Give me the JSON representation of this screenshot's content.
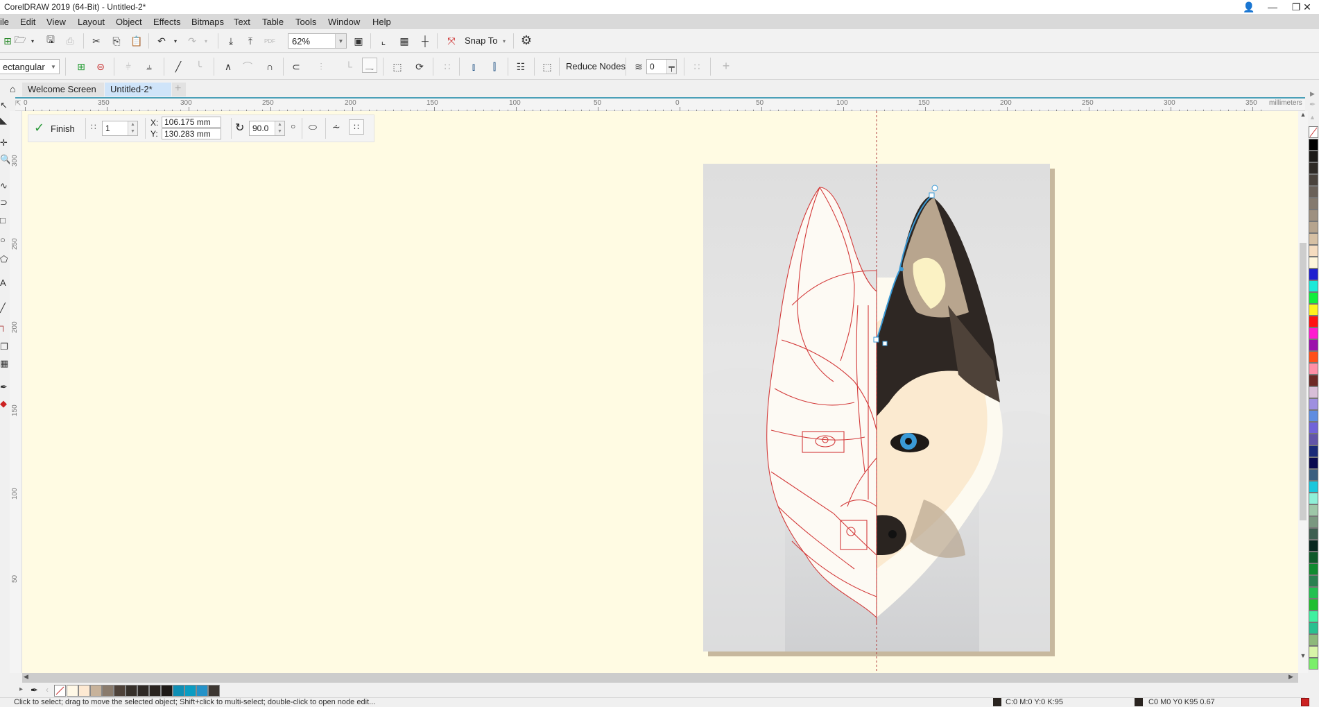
{
  "window": {
    "title": "CorelDRAW 2019 (64-Bit) - Untitled-2*",
    "controls": [
      "account-icon",
      "minimize-icon",
      "restore-icon",
      "close-icon"
    ]
  },
  "menu": [
    "ile",
    "Edit",
    "View",
    "Layout",
    "Object",
    "Effects",
    "Bitmaps",
    "Text",
    "Table",
    "Tools",
    "Window",
    "Help"
  ],
  "standard_toolbar": {
    "zoom_level": "62%",
    "snap_to_label": "Snap To",
    "pdf_label": "PDF"
  },
  "property_bar": {
    "selection_mode": "ectangular",
    "reduce_nodes_label": "Reduce Nodes",
    "curve_smoothness": "0"
  },
  "document_tabs": [
    {
      "label": "Welcome Screen",
      "active": false
    },
    {
      "label": "Untitled-2*",
      "active": true
    }
  ],
  "horizontal_ruler": {
    "labels": [
      "0",
      "350",
      "300",
      "250",
      "200",
      "150",
      "100",
      "50",
      "0",
      "50",
      "100",
      "150",
      "200",
      "250",
      "300",
      "350"
    ],
    "units": "millimeters"
  },
  "vertical_ruler": {
    "labels": [
      "300",
      "250",
      "200",
      "150",
      "100",
      "50"
    ]
  },
  "node_edit_bar": {
    "finish_label": "Finish",
    "node_count": "1",
    "x_label": "X:",
    "x_value": "106.175 mm",
    "y_label": "Y:",
    "y_value": "130.283 mm",
    "rotation": "90.0"
  },
  "document_palette": {
    "colors": [
      "#fff8e6",
      "#fde9d2",
      "#c7b29a",
      "#8a7b6c",
      "#4e4239",
      "#36302a",
      "#2e2925",
      "#2a2420",
      "#1e1a17",
      "#0f8fb5",
      "#0b9cc2",
      "#2492c8",
      "#3d3732"
    ]
  },
  "color_palette": {
    "colors": [
      "#000000",
      "#1c1a18",
      "#2e2a26",
      "#4a433d",
      "#6a6159",
      "#857a6e",
      "#9e9080",
      "#b6a48e",
      "#d6c0a4",
      "#f5dcc0",
      "#fff6dc",
      "#1f1fd0",
      "#1de9d9",
      "#12ee3c",
      "#fff21f",
      "#ff1212",
      "#ff1ad0",
      "#9b11ab",
      "#ff4f1a",
      "#ff8fa6",
      "#6e2a26",
      "#d8bfd8",
      "#9e8fe0",
      "#5f8de0",
      "#7163d8",
      "#6255a8",
      "#1a2a78",
      "#0a0a50",
      "#3a5f80",
      "#1bc7dc",
      "#8ff0d8",
      "#9ec7a8",
      "#7a9880",
      "#3d5e50",
      "#08281f",
      "#0e5a2a",
      "#0f8a2f",
      "#2a8050",
      "#22c050",
      "#1fbf2f",
      "#3ff0a0",
      "#2ac090",
      "#8db87a",
      "#d8f5a8",
      "#7aef6a"
    ]
  },
  "status_bar": {
    "hint": "Click to select; drag to move the selected object; Shift+click to multi-select; double-click to open node edit...",
    "fill_info": "C:0 M:0 Y:0 K:95",
    "outline_info": "C0 M0 Y0 K95  0.67"
  },
  "artwork": {
    "description": "Husky/wolf head illustration, left half shown as red wireframe, right half filled",
    "colors": {
      "wireframe": "#d33a3a",
      "ear_dark": "#2e2723",
      "ear_inner": "#b8a58e",
      "ear_highlight": "#fbf2c4",
      "face_cream": "#fbead0",
      "face_light": "#fdfaf0",
      "eye_iris": "#3a9ad6",
      "nose": "#2a2420",
      "page_bg": "#dcdcdc",
      "node_selection": "#3a9ad6"
    }
  }
}
